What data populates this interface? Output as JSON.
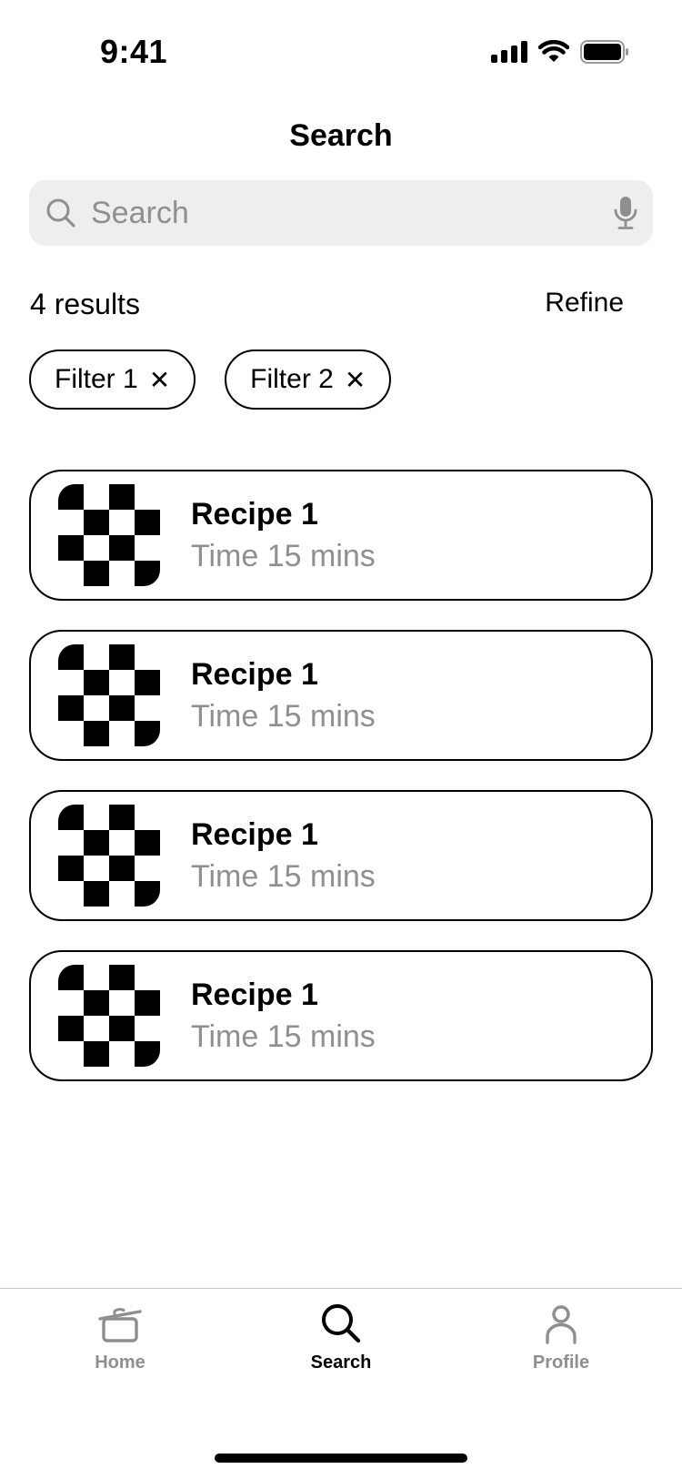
{
  "status_bar": {
    "time": "9:41"
  },
  "header": {
    "title": "Search"
  },
  "search": {
    "placeholder": "Search",
    "value": ""
  },
  "results": {
    "count_label": "4 results",
    "refine_label": "Refine"
  },
  "filters": [
    {
      "label": "Filter 1",
      "remove_glyph": "✕"
    },
    {
      "label": "Filter 2",
      "remove_glyph": "✕"
    }
  ],
  "recipes": [
    {
      "title": "Recipe 1",
      "subtitle": "Time 15 mins"
    },
    {
      "title": "Recipe 1",
      "subtitle": "Time 15 mins"
    },
    {
      "title": "Recipe 1",
      "subtitle": "Time 15 mins"
    },
    {
      "title": "Recipe 1",
      "subtitle": "Time 15 mins"
    }
  ],
  "tabbar": {
    "tabs": [
      {
        "label": "Home",
        "icon": "pot-icon",
        "active": false
      },
      {
        "label": "Search",
        "icon": "search-icon",
        "active": true
      },
      {
        "label": "Profile",
        "icon": "person-icon",
        "active": false
      }
    ]
  },
  "colors": {
    "placeholder_gray": "#8e8e93",
    "field_bg": "#eeeeee",
    "text": "#000000"
  }
}
